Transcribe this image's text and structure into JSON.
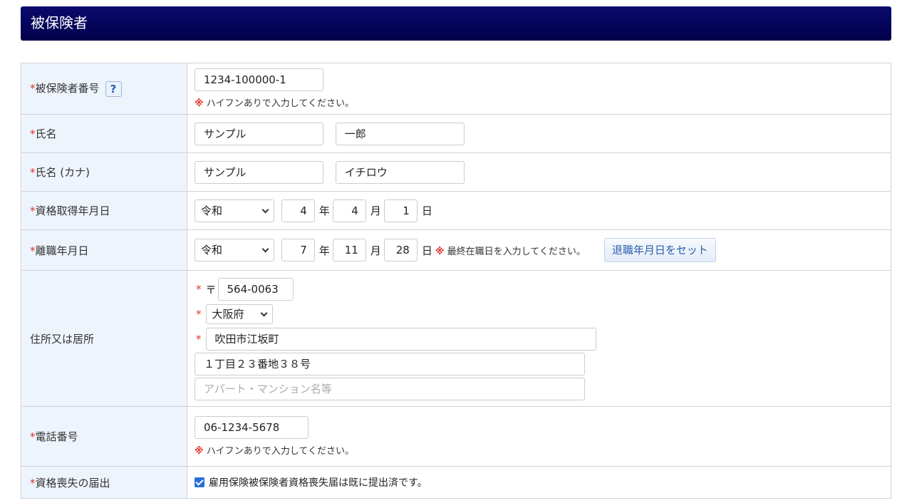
{
  "header": {
    "title": "被保険者"
  },
  "required_mark": "*",
  "rows": {
    "insured_number": {
      "label": "被保険者番号",
      "help": "?",
      "value": "1234-100000-1",
      "note_mark": "※",
      "note": "ハイフンありで入力してください。"
    },
    "name": {
      "label": "氏名",
      "last": "サンプル",
      "first": "一郎"
    },
    "name_kana": {
      "label": "氏名 (カナ)",
      "last": "サンプル",
      "first": "イチロウ"
    },
    "acquisition_date": {
      "label": "資格取得年月日",
      "era": "令和",
      "year": "4",
      "month": "4",
      "day": "1",
      "year_unit": "年",
      "month_unit": "月",
      "day_unit": "日"
    },
    "resignation_date": {
      "label": "離職年月日",
      "era": "令和",
      "year": "7",
      "month": "11",
      "day": "28",
      "year_unit": "年",
      "month_unit": "月",
      "day_unit": "日",
      "note_mark": "※",
      "note": "最終在職日を入力してください。",
      "button": "退職年月日をセット"
    },
    "address": {
      "label": "住所又は居所",
      "postal_symbol": "〒",
      "postal": "564-0063",
      "prefecture": "大阪府",
      "city": "吹田市江坂町",
      "street": "１丁目２３番地３８号",
      "building_placeholder": "アパート・マンション名等"
    },
    "phone": {
      "label": "電話番号",
      "value": "06-1234-5678",
      "note_mark": "※",
      "note": "ハイフンありで入力してください。"
    },
    "loss_notice": {
      "label": "資格喪失の届出",
      "checked": true,
      "checkbox_label": "雇用保険被保険者資格喪失届は既に提出済です。"
    }
  }
}
